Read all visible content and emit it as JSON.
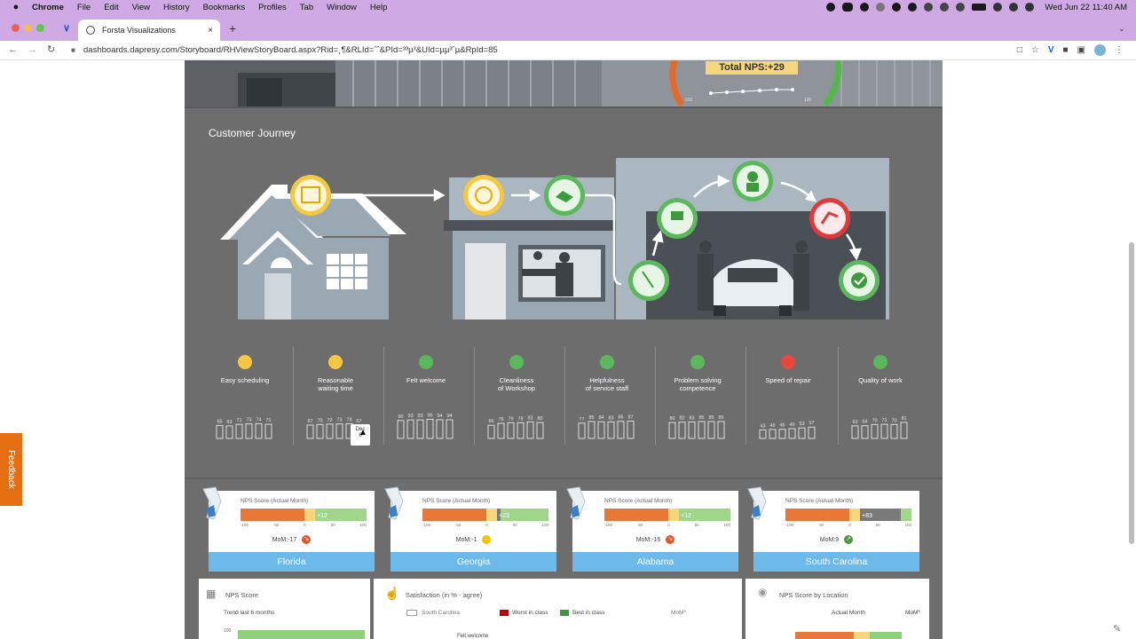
{
  "menubar": {
    "apple": "",
    "app": "Chrome",
    "items": [
      "File",
      "Edit",
      "View",
      "History",
      "Bookmarks",
      "Profiles",
      "Tab",
      "Window",
      "Help"
    ],
    "datetime": "Wed Jun 22  11:40 AM"
  },
  "tab": {
    "title": "Forsta Visualizations",
    "close": "×",
    "new": "+"
  },
  "address": {
    "url": "dashboards.dapresy.com/Storyboard/RHViewStoryBoard.aspx?Rid=¸¶&RLId=ˆˆ&PId=³³µ³&UId=µµ³ˆµ&RpId=85"
  },
  "banner": {
    "total_nps": "Total NPS:+29",
    "gauge_min": "-100",
    "gauge_max": "100"
  },
  "journey": {
    "title": "Customer Journey",
    "metrics": [
      {
        "label": "Easy scheduling",
        "values": [
          65,
          63,
          71,
          73,
          74,
          71
        ],
        "color": "#f5c842",
        "icon": "calendar-icon"
      },
      {
        "label": "Reasonable\nwaiting time",
        "values": [
          67,
          70,
          72,
          73,
          74,
          67
        ],
        "color": "#f5c842",
        "icon": "clock-icon"
      },
      {
        "label": "Felt welcome",
        "values": [
          90,
          93,
          93,
          96,
          94,
          94
        ],
        "color": "#5cb85c",
        "icon": "handshake-icon"
      },
      {
        "label": "Cleanliness\nof Workshop",
        "values": [
          66,
          76,
          79,
          79,
          83,
          80
        ],
        "color": "#5cb85c",
        "icon": "broom-icon"
      },
      {
        "label": "Helpfulness\nof service staff",
        "values": [
          77,
          85,
          84,
          83,
          86,
          87
        ],
        "color": "#5cb85c",
        "icon": "advisor-icon"
      },
      {
        "label": "Problem solving\ncompetence",
        "values": [
          80,
          82,
          83,
          85,
          85,
          85
        ],
        "color": "#5cb85c",
        "icon": "mechanic-icon"
      },
      {
        "label": "Speed of repair",
        "values": [
          43,
          45,
          46,
          49,
          53,
          57
        ],
        "color": "#e8473b",
        "icon": "running-icon"
      },
      {
        "label": "Quality of work",
        "values": [
          63,
          64,
          70,
          71,
          70,
          81
        ],
        "color": "#5cb85c",
        "icon": "badge-check-icon"
      }
    ],
    "tooltip": {
      "line1": "Dec",
      "line2": "6"
    }
  },
  "states": [
    {
      "title": "NPS Score (Actual Month)",
      "name": "Florida",
      "score": "+12",
      "score_value": 12,
      "mom": "MoM:-17",
      "mom_dir": "down",
      "mom_color": "#e0572a"
    },
    {
      "title": "NPS Score (Actual Month)",
      "name": "Georgia",
      "score": "+23",
      "score_value": 23,
      "mom": "MoM:-1",
      "mom_dir": "right",
      "mom_color": "#f5c400"
    },
    {
      "title": "NPS Score (Actual Month)",
      "name": "Alabama",
      "score": "+12",
      "score_value": 12,
      "mom": "MoM:-16",
      "mom_dir": "down",
      "mom_color": "#e0572a"
    },
    {
      "title": "NPS Score (Actual Month)",
      "name": "South Carolina",
      "score": "+83",
      "score_value": 83,
      "mom": "MoM:9",
      "mom_dir": "up",
      "mom_color": "#4a9a3a"
    }
  ],
  "scale_labels": [
    "-100",
    "-50",
    "0",
    "50",
    "100"
  ],
  "panels": {
    "nps": {
      "title": "NPS Score",
      "subtitle": "Trend last 6 months",
      "axis_top": "100"
    },
    "satisfaction": {
      "title": "Satisfaction (in % - agree)",
      "legend": [
        "South Carolina",
        "Worst in class",
        "Best in class"
      ],
      "mom": "MoM*",
      "row_label": "Felt welcome"
    },
    "location": {
      "title": "NPS Score by Location",
      "col1": "Actual Month",
      "col2": "MoM*"
    }
  },
  "feedback": "Feedback",
  "colors": {
    "chrome": "#cfa9e3",
    "panel": "#6d6d6d",
    "state_blue": "#6db9ea",
    "orange": "#e8773a",
    "green": "#8fd17a"
  }
}
